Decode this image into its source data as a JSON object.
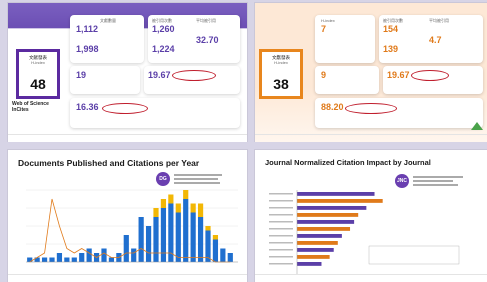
{
  "slide1": {
    "wos_label": "Web of Science\nInCites",
    "big_box_title": "文献發表",
    "big_box_sub": "H-index",
    "big_box_value": "48",
    "stats": [
      {
        "value": "1,112",
        "label": "文獻數量"
      },
      {
        "value": "1,998",
        "label": "被引用次數"
      },
      {
        "value": "1,260",
        "label": "被引用次數"
      },
      {
        "value": "1,224",
        "label": "引用文獻"
      },
      {
        "value": "32.70",
        "label": "平均被引用"
      },
      {
        "value": "19",
        "label": "H-index"
      },
      {
        "value": "19.67",
        "label": "國際合作"
      },
      {
        "value": "16.36",
        "label": "資料來源"
      }
    ]
  },
  "slide2": {
    "big_box_title": "文獻發表",
    "big_box_sub": "H-index",
    "big_box_value": "38",
    "stats": [
      {
        "value": "7",
        "label": "H-index"
      },
      {
        "value": "154",
        "label": "被引用次數"
      },
      {
        "value": "4.7",
        "label": "平均被引用"
      },
      {
        "value": "139",
        "label": "引用文獻"
      },
      {
        "value": "9",
        "label": "10 index"
      },
      {
        "value": "19.67",
        "label": "國際合作"
      },
      {
        "value": "88.20",
        "label": "資料來源"
      }
    ]
  },
  "slide3": {
    "title": "Documents Published and Citations per Year",
    "badge": "DG",
    "chart_data": {
      "type": "bar",
      "categories": [
        "1",
        "2",
        "3",
        "4",
        "5",
        "6",
        "7",
        "8",
        "9",
        "10",
        "11",
        "12",
        "13",
        "14",
        "15",
        "16",
        "17",
        "18",
        "19",
        "20",
        "21",
        "22",
        "23",
        "24",
        "25",
        "26",
        "27",
        "28"
      ],
      "series": [
        {
          "values": [
            1,
            1,
            1,
            1,
            2,
            1,
            1,
            2,
            3,
            2,
            3,
            1,
            2,
            6,
            3,
            10,
            8,
            10,
            12,
            13,
            11,
            14,
            11,
            10,
            7,
            5,
            3,
            2
          ]
        },
        {
          "values": [
            0,
            0,
            0,
            0,
            0,
            0,
            0,
            0,
            0,
            0,
            0,
            0,
            0,
            0,
            0,
            0,
            0,
            2,
            2,
            2,
            2,
            2,
            2,
            3,
            1,
            1,
            0,
            0
          ]
        }
      ],
      "line": [
        0,
        1,
        2,
        14,
        8,
        3,
        2,
        3,
        2,
        1,
        2,
        1,
        1,
        2,
        2,
        3,
        2,
        2,
        2,
        2,
        1,
        1,
        1,
        1,
        1,
        0,
        0,
        0
      ],
      "colors": {
        "bar": "#1f6fcf",
        "bar2": "#f2b705",
        "line": "#e07a1a"
      }
    }
  },
  "slide4": {
    "title": "Journal Normalized Citation Impact by Journal",
    "badge": "JNC",
    "chart_data": {
      "type": "bar",
      "orientation": "horizontal",
      "values": [
        1.9,
        2.1,
        1.7,
        1.5,
        1.4,
        1.3,
        1.1,
        1.0,
        0.9,
        0.8,
        0.6
      ],
      "colors": [
        "#5b3fa8",
        "#e07a1a",
        "#5b3fa8",
        "#e07a1a",
        "#5b3fa8",
        "#e07a1a",
        "#5b3fa8",
        "#e07a1a",
        "#5b3fa8",
        "#e07a1a",
        "#5b3fa8"
      ]
    }
  },
  "colors": {
    "purple": "#5b3fa8",
    "orange": "#e07a1a",
    "red": "#c01f2e",
    "blue": "#1f6fcf",
    "yellow": "#f2b705"
  }
}
